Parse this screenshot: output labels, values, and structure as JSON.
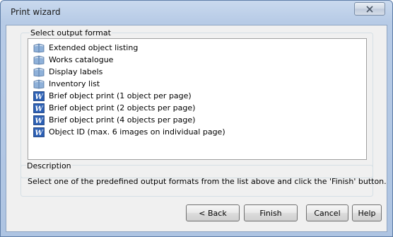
{
  "window": {
    "title": "Print wizard"
  },
  "format_group": {
    "label": "Select output format",
    "items": [
      {
        "label": "Extended object listing",
        "icon": "book-icon"
      },
      {
        "label": "Works catalogue",
        "icon": "book-icon"
      },
      {
        "label": "Display labels",
        "icon": "book-icon"
      },
      {
        "label": "Inventory list",
        "icon": "book-icon"
      },
      {
        "label": "Brief object print (1 object per page)",
        "icon": "word-document-icon"
      },
      {
        "label": "Brief object print (2 objects per page)",
        "icon": "word-document-icon"
      },
      {
        "label": "Brief object print (4 objects per page)",
        "icon": "word-document-icon"
      },
      {
        "label": "Object ID (max. 6 images on individual page)",
        "icon": "word-document-icon"
      }
    ]
  },
  "description": {
    "label": "Description",
    "text": "Select one of the predefined output formats from the list above and click the 'Finish' button."
  },
  "buttons": {
    "back": "< Back",
    "finish": "Finish",
    "cancel": "Cancel",
    "help": "Help"
  }
}
